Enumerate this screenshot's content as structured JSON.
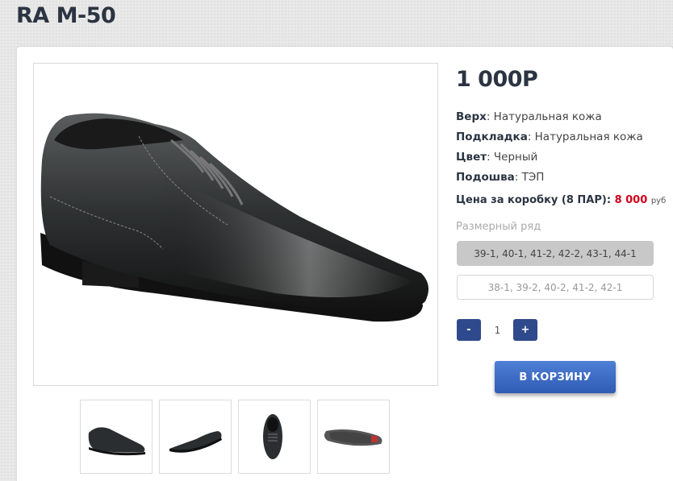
{
  "product": {
    "title": "RA M-50",
    "price": "1 000Р"
  },
  "specs": [
    {
      "label": "Верх",
      "value": ": Натуральная кожа"
    },
    {
      "label": "Подкладка",
      "value": ": Натуральная кожа"
    },
    {
      "label": "Цвет",
      "value": ": Черный"
    },
    {
      "label": "Подошва",
      "value": ": ТЭП"
    }
  ],
  "box_price": {
    "label": "Цена за коробку (8 ПАР):",
    "value": "8 000",
    "currency": "руб"
  },
  "sizes": {
    "label": "Размерный ряд",
    "options": [
      "39-1, 40-1, 41-2, 42-2, 43-1, 44-1",
      "38-1, 39-2, 40-2, 41-2, 42-1"
    ],
    "selected_index": 0
  },
  "quantity": {
    "minus": "-",
    "value": "1",
    "plus": "+"
  },
  "cart": {
    "label": "В КОРЗИНУ"
  },
  "thumbnails": [
    "shoe-side-icon",
    "shoe-angle-icon",
    "shoe-top-icon",
    "shoe-sole-icon"
  ],
  "colors": {
    "accent": "#2e4a8c",
    "cart": "#3b67c2",
    "price_red": "#d0011b"
  }
}
